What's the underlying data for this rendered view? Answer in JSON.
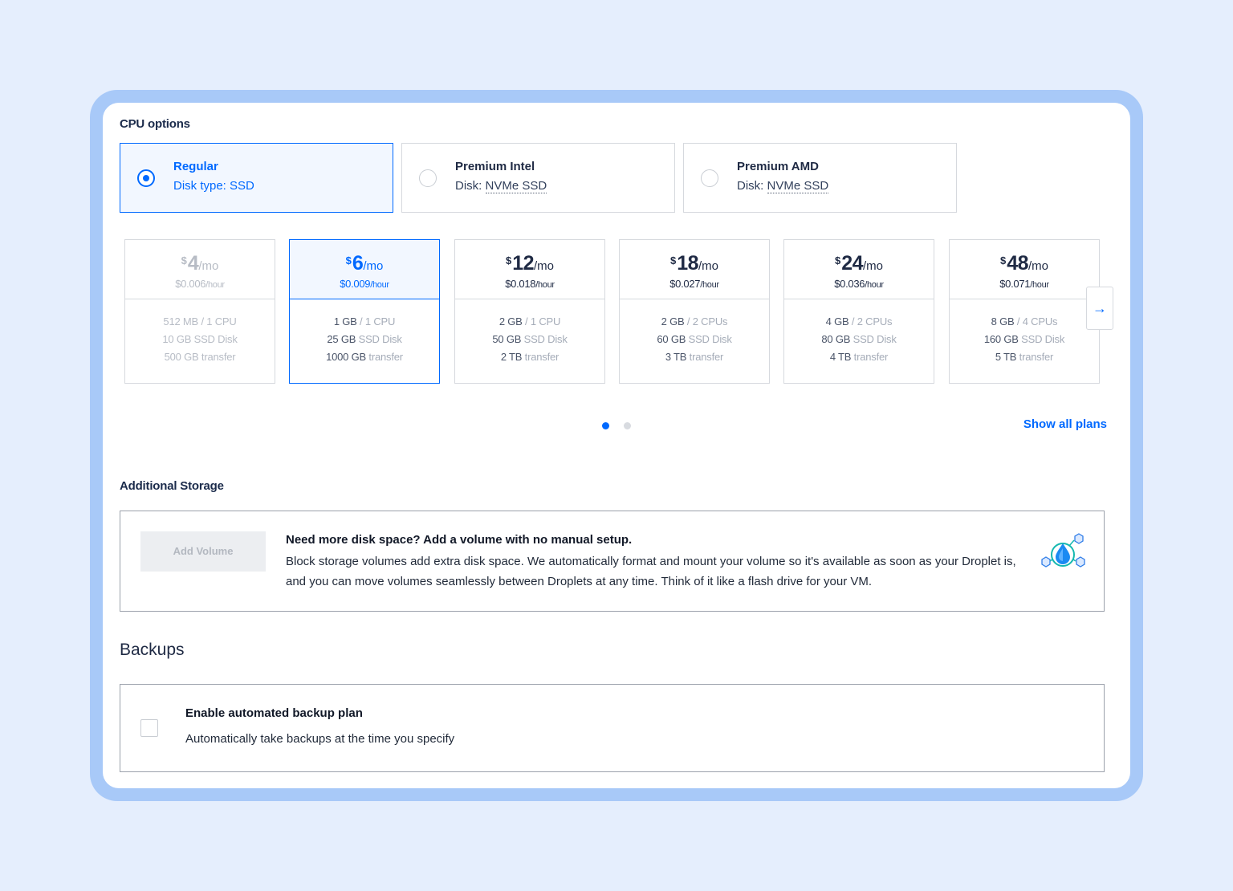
{
  "cpu_options": {
    "label": "CPU options",
    "options": [
      {
        "title": "Regular",
        "sub_prefix": "Disk type: ",
        "sub_value": "SSD",
        "selected": true
      },
      {
        "title": "Premium Intel",
        "sub_prefix": "Disk: ",
        "sub_value": "NVMe SSD",
        "selected": false
      },
      {
        "title": "Premium AMD",
        "sub_prefix": "Disk: ",
        "sub_value": "NVMe SSD",
        "selected": false
      }
    ]
  },
  "plans": [
    {
      "currency": "$",
      "amount": "4",
      "per": "/mo",
      "hourly": "$0.006",
      "hourly_unit": "/hour",
      "mem": "512 MB",
      "cpu": " / 1 CPU",
      "disk": "10 GB",
      "disk_type": " SSD Disk",
      "transfer": "500 GB",
      "transfer_label": " transfer",
      "state": "disabled"
    },
    {
      "currency": "$",
      "amount": "6",
      "per": "/mo",
      "hourly": "$0.009",
      "hourly_unit": "/hour",
      "mem": "1 GB",
      "cpu": " / 1 CPU",
      "disk": "25 GB",
      "disk_type": " SSD Disk",
      "transfer": "1000 GB",
      "transfer_label": " transfer",
      "state": "selected"
    },
    {
      "currency": "$",
      "amount": "12",
      "per": "/mo",
      "hourly": "$0.018",
      "hourly_unit": "/hour",
      "mem": "2 GB",
      "cpu": " / 1 CPU",
      "disk": "50 GB",
      "disk_type": " SSD Disk",
      "transfer": "2 TB",
      "transfer_label": " transfer",
      "state": "normal"
    },
    {
      "currency": "$",
      "amount": "18",
      "per": "/mo",
      "hourly": "$0.027",
      "hourly_unit": "/hour",
      "mem": "2 GB",
      "cpu": " / 2 CPUs",
      "disk": "60 GB",
      "disk_type": " SSD Disk",
      "transfer": "3 TB",
      "transfer_label": " transfer",
      "state": "normal"
    },
    {
      "currency": "$",
      "amount": "24",
      "per": "/mo",
      "hourly": "$0.036",
      "hourly_unit": "/hour",
      "mem": "4 GB",
      "cpu": " / 2 CPUs",
      "disk": "80 GB",
      "disk_type": " SSD Disk",
      "transfer": "4 TB",
      "transfer_label": " transfer",
      "state": "normal"
    },
    {
      "currency": "$",
      "amount": "48",
      "per": "/mo",
      "hourly": "$0.071",
      "hourly_unit": "/hour",
      "mem": "8 GB",
      "cpu": " / 4 CPUs",
      "disk": "160 GB",
      "disk_type": " SSD Disk",
      "transfer": "5 TB",
      "transfer_label": " transfer",
      "state": "normal"
    }
  ],
  "carousel": {
    "next_icon": "arrow-right-icon",
    "next_glyph": "→",
    "pages": 2,
    "active_page": 1
  },
  "show_all_plans": "Show all plans",
  "storage": {
    "label": "Additional Storage",
    "button": "Add Volume",
    "title": "Need more disk space? Add a volume with no manual setup.",
    "description": "Block storage volumes add extra disk space. We automatically format and mount your volume so it's available as soon as your Droplet is, and you can move volumes seamlessly between Droplets at any time. Think of it like a flash drive for your VM.",
    "icon": "volume-droplet-icon"
  },
  "backups": {
    "label": "Backups",
    "title": "Enable automated backup plan",
    "description": "Automatically take backups at the time you specify",
    "checked": false
  },
  "colors": {
    "accent": "#0069ff",
    "page_bg": "#e5eefd",
    "frame": "#a8c9f8"
  }
}
